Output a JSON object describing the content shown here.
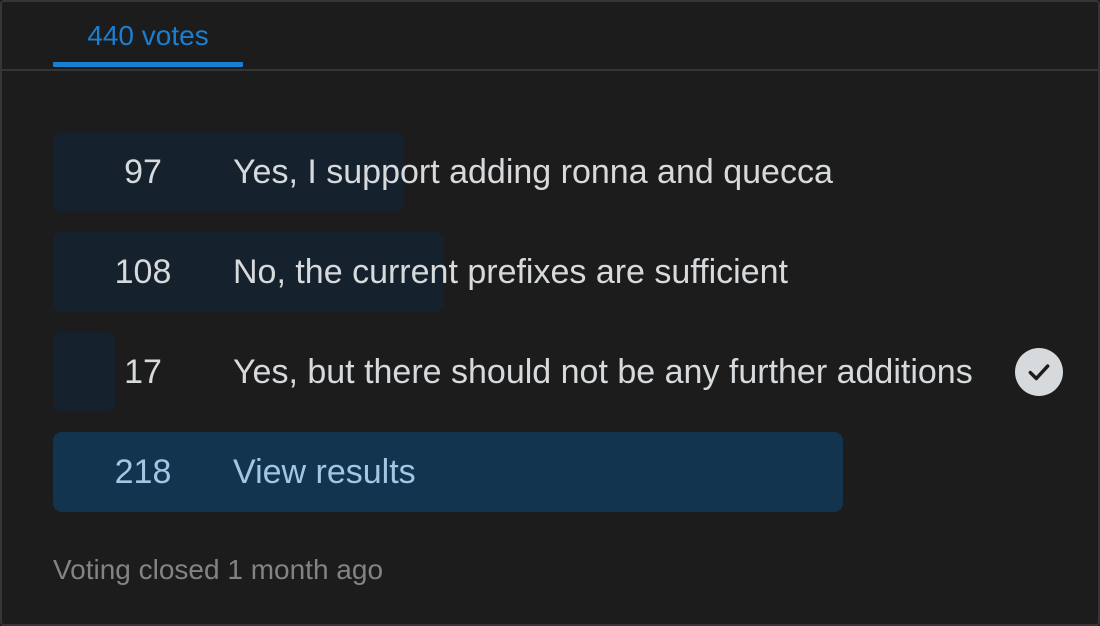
{
  "poll": {
    "tab_label": "440 votes",
    "options": [
      {
        "count": "97",
        "label": "Yes, I support adding ronna and quecca",
        "fraction": 0.4442
      },
      {
        "count": "108",
        "label": "No, the current prefixes are sufficient",
        "fraction": 0.4948
      },
      {
        "count": "17",
        "label": "Yes, but there should not be any further additions",
        "fraction": 0.0779,
        "selected": true
      },
      {
        "count": "218",
        "label": "View results",
        "fraction": 1.0
      }
    ],
    "status": "Voting closed 1 month ago"
  },
  "colors": {
    "accent": "#1a7ed2",
    "bar": "#15222d",
    "bar_highlight": "#12344f",
    "text": "#d7dadc",
    "muted": "#818384"
  },
  "icons": {
    "selected_marker": "check-circle-icon"
  }
}
